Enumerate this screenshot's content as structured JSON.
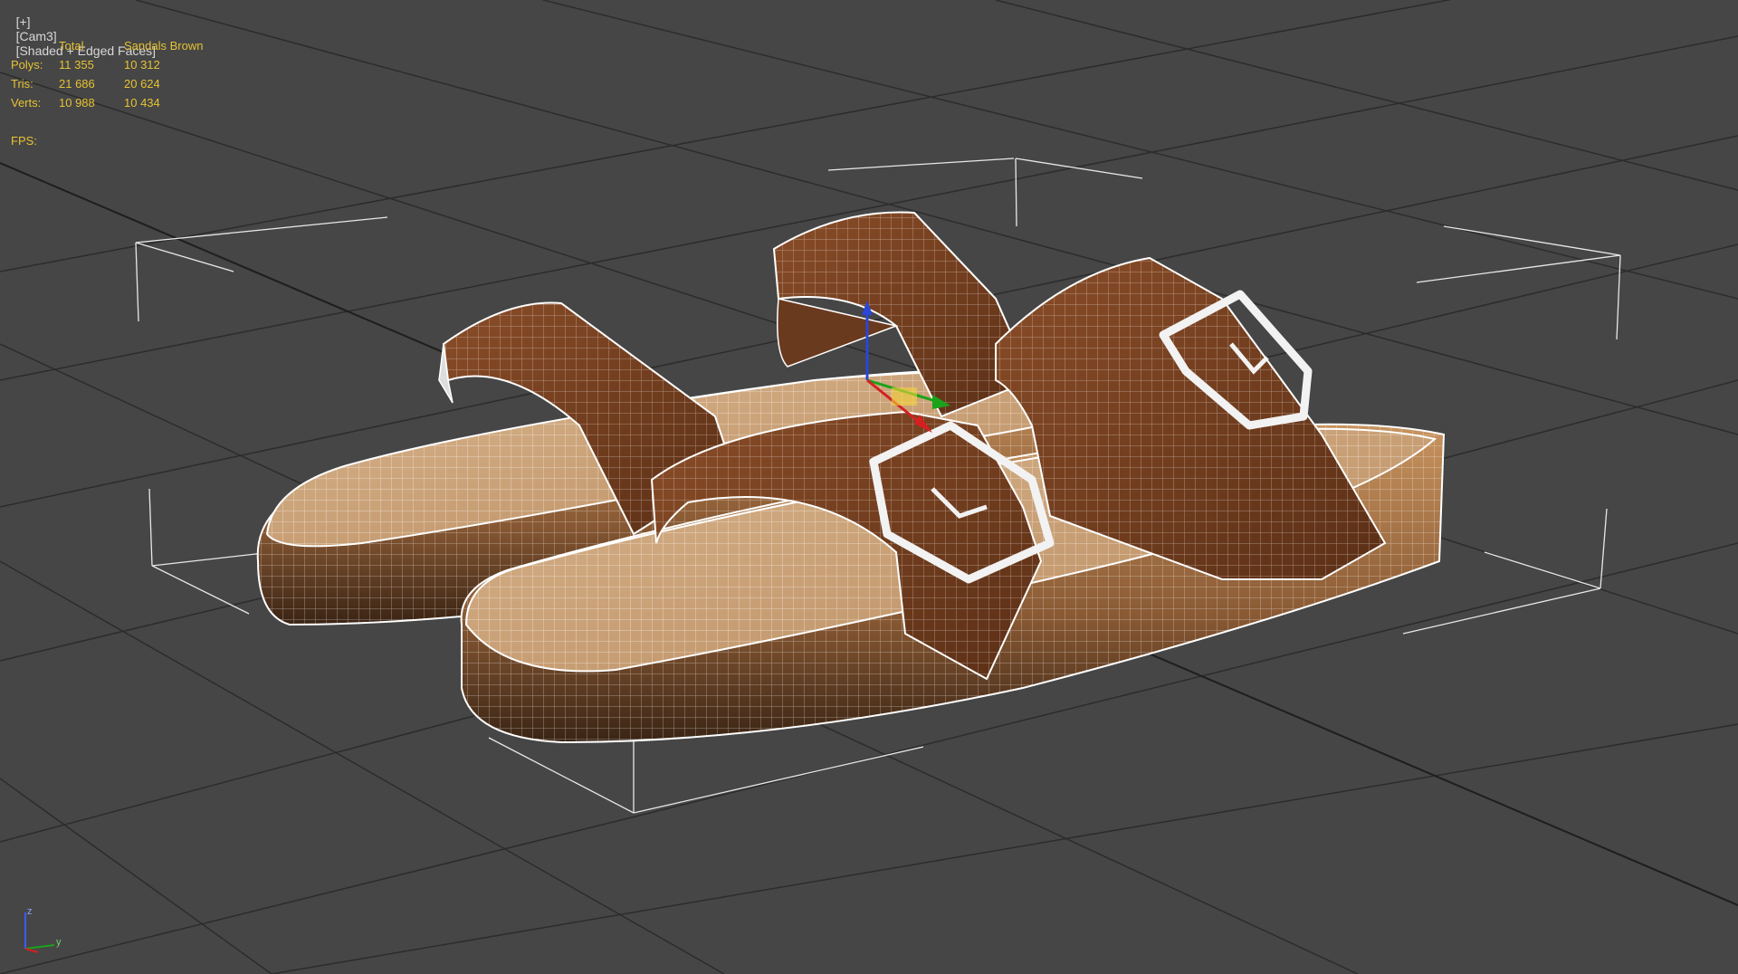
{
  "viewport_label": {
    "plus": "[+]",
    "camera": "[Cam3]",
    "shading": "[Shaded + Edged Faces]"
  },
  "stats": {
    "headers": [
      "",
      "Total",
      "Sandals Brown"
    ],
    "rows": [
      {
        "label": "Polys:",
        "total": "11 355",
        "selected": "10 312"
      },
      {
        "label": "Tris:",
        "total": "21 686",
        "selected": "20 624"
      },
      {
        "label": "Verts:",
        "total": "10 988",
        "selected": "10 434"
      }
    ],
    "fps_label": "FPS:"
  },
  "tripod": {
    "z": "z",
    "y": "y"
  },
  "colors": {
    "background": "#464646",
    "grid": "#2a2a2a",
    "stats_text": "#e6c233",
    "strap_brown": "#7a4322",
    "footbed_tan": "#c9a27a",
    "wire": "#ffffff"
  },
  "icons": [
    "axis-tripod-icon",
    "transform-gizmo-icon"
  ]
}
